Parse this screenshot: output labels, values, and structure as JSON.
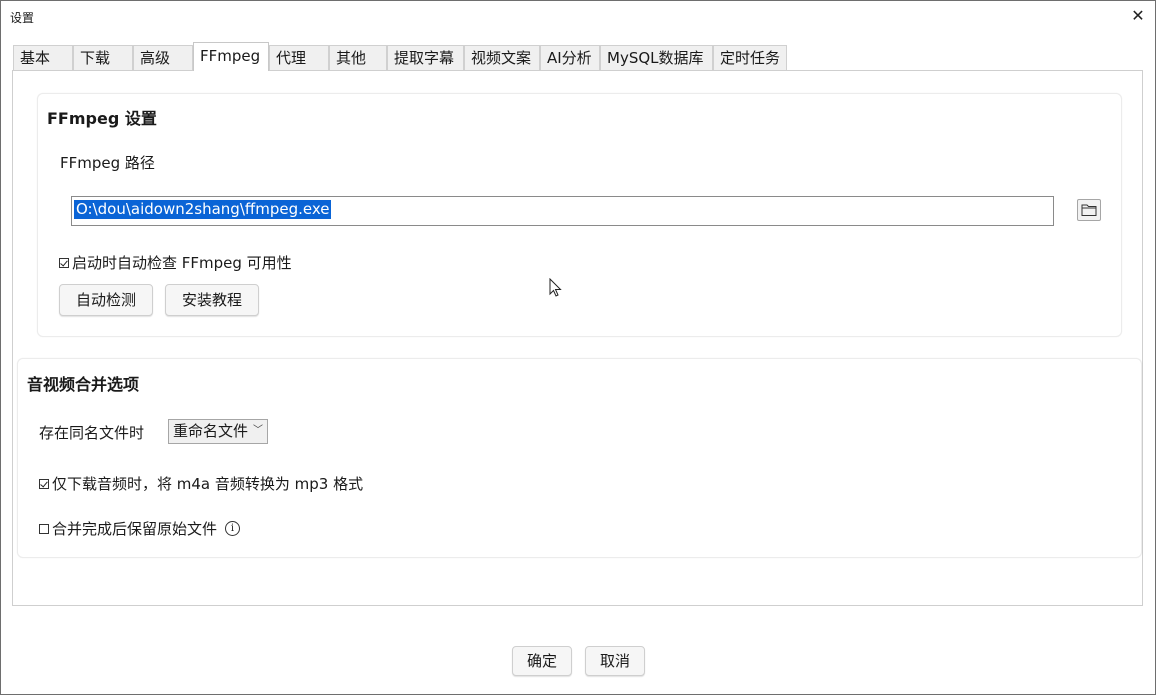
{
  "window": {
    "title": "设置",
    "close_glyph": "✕"
  },
  "tabs": [
    {
      "label": "基本"
    },
    {
      "label": "下载"
    },
    {
      "label": "高级"
    },
    {
      "label": "FFmpeg"
    },
    {
      "label": "代理"
    },
    {
      "label": "其他"
    },
    {
      "label": "提取字幕"
    },
    {
      "label": "视频文案"
    },
    {
      "label": "AI分析"
    },
    {
      "label": "MySQL数据库"
    },
    {
      "label": "定时任务"
    }
  ],
  "active_tab": "FFmpeg",
  "ffmpeg_group": {
    "title": "FFmpeg 设置",
    "path_label": "FFmpeg 路径",
    "path_value": "O:\\dou\\aidown2shang\\ffmpeg.exe",
    "browse_icon": "folder-icon",
    "auto_check_label": "启动时自动检查 FFmpeg 可用性",
    "auto_check_checked": true,
    "detect_button": "自动检测",
    "tutorial_button": "安装教程"
  },
  "merge_group": {
    "title": "音视频合并选项",
    "conflict_label": "存在同名文件时",
    "conflict_value": "重命名文件",
    "convert_label": "仅下载音频时，将 m4a 音频转换为 mp3 格式",
    "convert_checked": true,
    "keep_label": "合并完成后保留原始文件",
    "keep_checked": false,
    "info_glyph": "i"
  },
  "footer": {
    "ok_label": "确定",
    "cancel_label": "取消"
  },
  "colors": {
    "selection": "#0a64d6",
    "border": "#cfcfcf"
  }
}
